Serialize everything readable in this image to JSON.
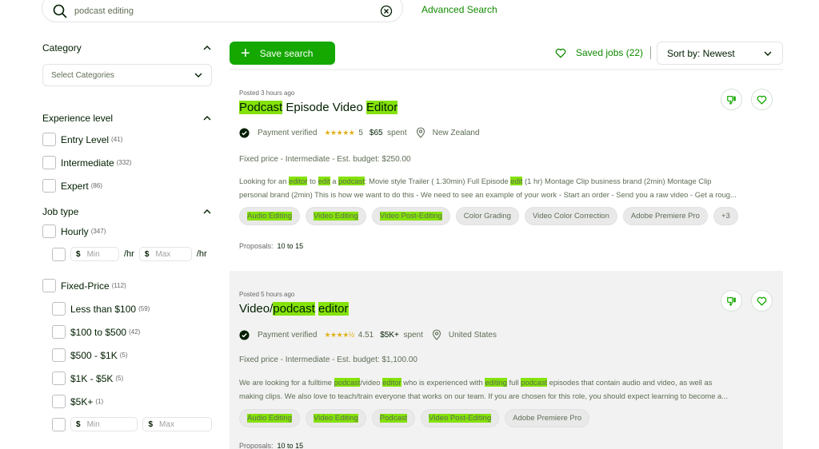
{
  "search": {
    "value": "podcast editing",
    "advanced_label": "Advanced Search"
  },
  "sidebar": {
    "category": {
      "title": "Category",
      "select_placeholder": "Select Categories"
    },
    "experience": {
      "title": "Experience level",
      "options": [
        {
          "label": "Entry Level",
          "count": "(41)"
        },
        {
          "label": "Intermediate",
          "count": "(332)"
        },
        {
          "label": "Expert",
          "count": "(86)"
        }
      ]
    },
    "job_type": {
      "title": "Job type",
      "hourly": {
        "label": "Hourly",
        "count": "(347)"
      },
      "hourly_min_placeholder": "Min",
      "hourly_max_placeholder": "Max",
      "currency": "$",
      "per_hour": "/hr",
      "fixed": {
        "label": "Fixed-Price",
        "count": "(112)"
      },
      "fixed_options": [
        {
          "label": "Less than $100",
          "count": "(59)"
        },
        {
          "label": "$100 to $500",
          "count": "(42)"
        },
        {
          "label": "$500 - $1K",
          "count": "(5)"
        },
        {
          "label": "$1K - $5K",
          "count": "(5)"
        },
        {
          "label": "$5K+",
          "count": "(1)"
        }
      ],
      "fixed_min_placeholder": "Min",
      "fixed_max_placeholder": "Max"
    }
  },
  "toolbar": {
    "save_search_label": "Save search",
    "saved_jobs_label": "Saved jobs (22)",
    "sort_label": "Sort by: Newest"
  },
  "jobs": [
    {
      "posted": "Posted 3 hours ago",
      "title_parts": [
        {
          "text": "Podcast",
          "hl": true
        },
        {
          "text": " Episode Video ",
          "hl": false
        },
        {
          "text": "Editor",
          "hl": true
        }
      ],
      "payment": "Payment verified",
      "stars": "★★★★★",
      "rating": "5",
      "spent_amount": "$65",
      "spent_label": "spent",
      "location": "New Zealand",
      "budget": "Fixed price - Intermediate - Est. budget: $250.00",
      "desc_line1": [
        {
          "text": "Looking for an ",
          "hl": false
        },
        {
          "text": "editor",
          "hl": true
        },
        {
          "text": " to ",
          "hl": false
        },
        {
          "text": "edit",
          "hl": true
        },
        {
          "text": " a ",
          "hl": false
        },
        {
          "text": "podcast",
          "hl": true
        },
        {
          "text": ": Movie style Trailer ( 1.30min) Full Episode ",
          "hl": false
        },
        {
          "text": "edit",
          "hl": true
        },
        {
          "text": " (1 hr) Montage Clip business brand (2min) Montage Clip",
          "hl": false
        }
      ],
      "desc_line2": "personal brand (2min) This is how we want to do this - We need to see an example of your work - Start an order - Send you a raw video - Get a roug...",
      "skills": [
        {
          "label": "Audio Editing",
          "hl": true
        },
        {
          "label": "Video Editing",
          "hl": true
        },
        {
          "label": "Video Post-Editing",
          "hl": true
        },
        {
          "label": "Color Grading",
          "hl": false
        },
        {
          "label": "Video Color Correction",
          "hl": false
        },
        {
          "label": "Adobe Premiere Pro",
          "hl": false
        },
        {
          "label": "+3",
          "hl": false
        }
      ],
      "proposals_label": "Proposals:",
      "proposals_value": "10 to 15"
    },
    {
      "posted": "Posted 5 hours ago",
      "title_parts": [
        {
          "text": "Video/",
          "hl": false
        },
        {
          "text": "podcast",
          "hl": true
        },
        {
          "text": " ",
          "hl": false
        },
        {
          "text": "editor",
          "hl": true
        }
      ],
      "payment": "Payment verified",
      "stars": "★★★★½",
      "rating": "4.51",
      "spent_amount": "$5K+",
      "spent_label": "spent",
      "location": "United States",
      "budget": "Fixed price - Intermediate - Est. budget: $1,100.00",
      "desc_line1": [
        {
          "text": "We are looking for a fulltime ",
          "hl": false
        },
        {
          "text": "podcast",
          "hl": true
        },
        {
          "text": "/video ",
          "hl": false
        },
        {
          "text": "editor",
          "hl": true
        },
        {
          "text": " who is experienced with ",
          "hl": false
        },
        {
          "text": "editing",
          "hl": true
        },
        {
          "text": " full ",
          "hl": false
        },
        {
          "text": "podcast",
          "hl": true
        },
        {
          "text": " episodes that contain audio and video, as well as",
          "hl": false
        }
      ],
      "desc_line2": "making clips. We also love to teach/train everyone that works on our team. If you are chosen for this role, you should expect learning to become a...",
      "skills": [
        {
          "label": "Audio Editing",
          "hl": true
        },
        {
          "label": "Video Editing",
          "hl": true
        },
        {
          "label": "Podcast",
          "hl": true
        },
        {
          "label": "Video Post-Editing",
          "hl": true
        },
        {
          "label": "Adobe Premiere Pro",
          "hl": false
        }
      ],
      "proposals_label": "Proposals:",
      "proposals_value": "10 to 15"
    }
  ],
  "colors": {
    "brand_green": "#14a800",
    "link_green": "#108a00",
    "highlight": "#85e20a",
    "star": "#e1b11a"
  }
}
